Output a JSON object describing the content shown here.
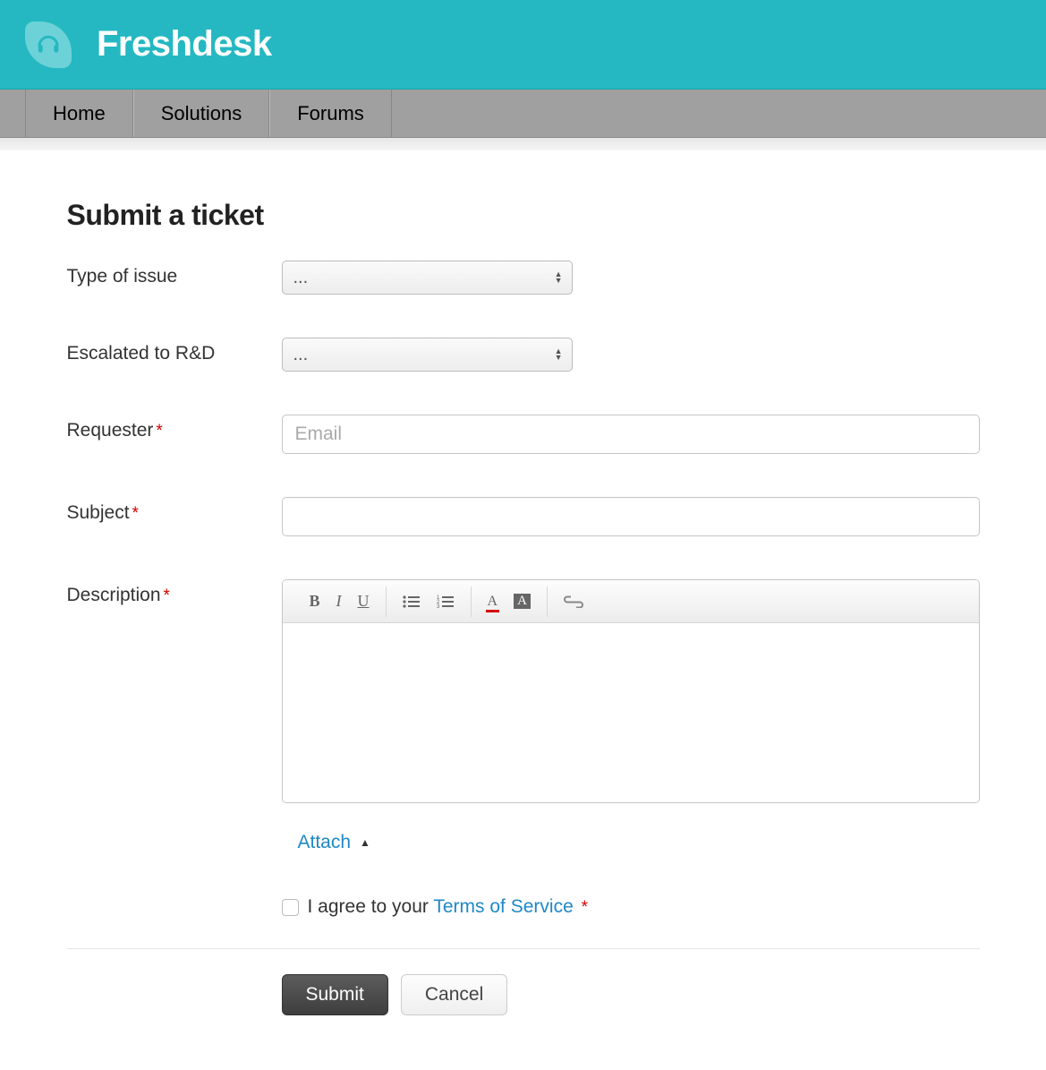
{
  "brand": {
    "name": "Freshdesk"
  },
  "nav": {
    "items": [
      "Home",
      "Solutions",
      "Forums"
    ]
  },
  "page": {
    "title": "Submit a ticket"
  },
  "form": {
    "fields": {
      "type_of_issue": {
        "label": "Type of issue",
        "selected": "..."
      },
      "escalated": {
        "label": "Escalated to R&D",
        "selected": "..."
      },
      "requester": {
        "label": "Requester",
        "placeholder": "Email",
        "value": ""
      },
      "subject": {
        "label": "Subject",
        "value": ""
      },
      "description": {
        "label": "Description"
      }
    },
    "attach": {
      "label": "Attach"
    },
    "tos": {
      "prefix": "I agree to your ",
      "link": "Terms of Service"
    },
    "buttons": {
      "submit": "Submit",
      "cancel": "Cancel"
    }
  }
}
